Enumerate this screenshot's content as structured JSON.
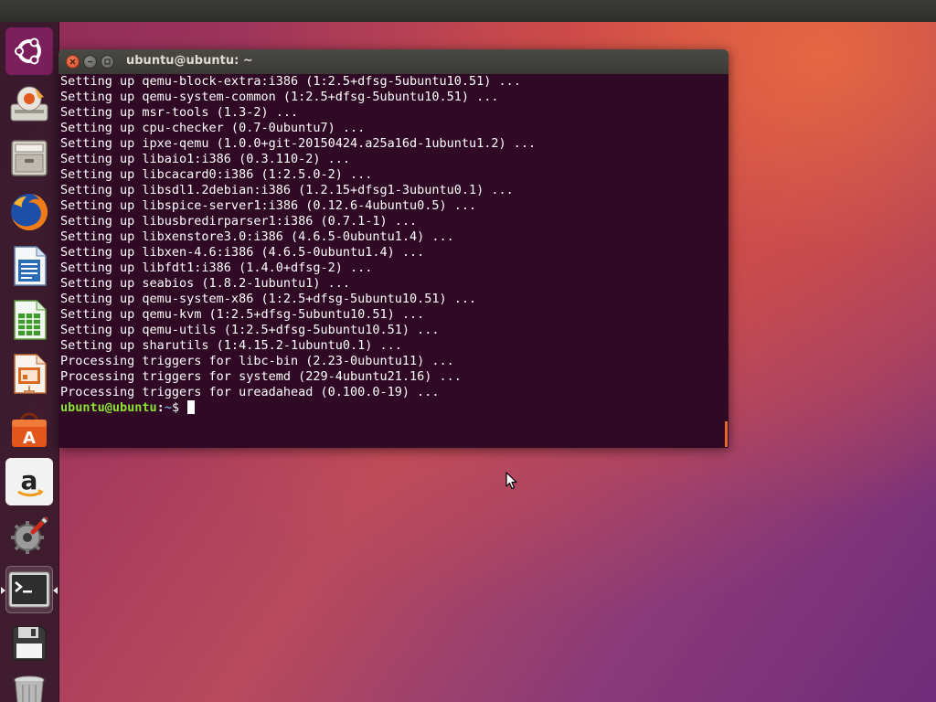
{
  "window": {
    "title": "ubuntu@ubuntu: ~"
  },
  "terminal": {
    "lines": [
      "Setting up qemu-block-extra:i386 (1:2.5+dfsg-5ubuntu10.51) ...",
      "Setting up qemu-system-common (1:2.5+dfsg-5ubuntu10.51) ...",
      "Setting up msr-tools (1.3-2) ...",
      "Setting up cpu-checker (0.7-0ubuntu7) ...",
      "Setting up ipxe-qemu (1.0.0+git-20150424.a25a16d-1ubuntu1.2) ...",
      "Setting up libaio1:i386 (0.3.110-2) ...",
      "Setting up libcacard0:i386 (1:2.5.0-2) ...",
      "Setting up libsdl1.2debian:i386 (1.2.15+dfsg1-3ubuntu0.1) ...",
      "Setting up libspice-server1:i386 (0.12.6-4ubuntu0.5) ...",
      "Setting up libusbredirparser1:i386 (0.7.1-1) ...",
      "Setting up libxenstore3.0:i386 (4.6.5-0ubuntu1.4) ...",
      "Setting up libxen-4.6:i386 (4.6.5-0ubuntu1.4) ...",
      "Setting up libfdt1:i386 (1.4.0+dfsg-2) ...",
      "Setting up seabios (1.8.2-1ubuntu1) ...",
      "Setting up qemu-system-x86 (1:2.5+dfsg-5ubuntu10.51) ...",
      "Setting up qemu-kvm (1:2.5+dfsg-5ubuntu10.51) ...",
      "Setting up qemu-utils (1:2.5+dfsg-5ubuntu10.51) ...",
      "Setting up sharutils (1:4.15.2-1ubuntu0.1) ...",
      "Processing triggers for libc-bin (2.23-0ubuntu11) ...",
      "Processing triggers for systemd (229-4ubuntu21.16) ...",
      "Processing triggers for ureadahead (0.100.0-19) ..."
    ],
    "prompt": {
      "user": "ubuntu@ubuntu",
      "separator": ":",
      "path": "~",
      "symbol": "$ "
    }
  },
  "launcher": {
    "items": [
      {
        "name": "ubuntu-dash-icon",
        "active": false
      },
      {
        "name": "install-ubuntu-icon",
        "active": false
      },
      {
        "name": "files-icon",
        "active": false
      },
      {
        "name": "firefox-icon",
        "active": false
      },
      {
        "name": "libreoffice-writer-icon",
        "active": false
      },
      {
        "name": "libreoffice-calc-icon",
        "active": false
      },
      {
        "name": "libreoffice-impress-icon",
        "active": false
      },
      {
        "name": "ubuntu-software-icon",
        "active": false
      },
      {
        "name": "amazon-icon",
        "active": false
      },
      {
        "name": "system-settings-icon",
        "active": false
      },
      {
        "name": "terminal-icon",
        "active": true
      },
      {
        "name": "save-disk-icon",
        "active": false
      },
      {
        "name": "trash-icon",
        "active": false
      }
    ]
  },
  "colors": {
    "terminal_background": "#300a24",
    "prompt_user": "#8ae234",
    "prompt_path": "#729fcf",
    "close_button": "#d84a26",
    "launcher_background": "#301828"
  }
}
